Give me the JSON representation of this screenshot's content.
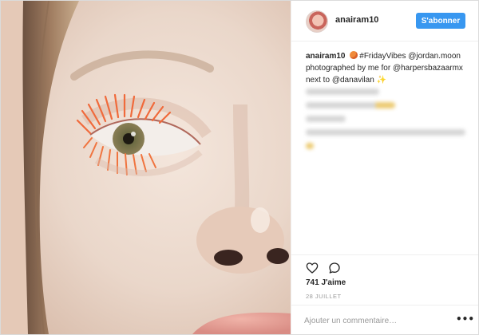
{
  "post": {
    "username": "anairam10",
    "follow_label": "S'abonner",
    "caption": {
      "author": "anairam10",
      "hashtag": "#FridayVibes",
      "mention_1": "@jordan.moon",
      "text_1": "photographed by me for",
      "mention_2": "@harpersbazaarmx",
      "text_2": "next to",
      "mention_3": "@danavilan",
      "emoji_icon": "fire-emoji",
      "sparkle_icon": "sparkles-emoji",
      "sparkle": "✨"
    },
    "likes": "741 J'aime",
    "date": "28 JUILLET",
    "comment_placeholder": "Ajouter un commentaire…",
    "more_label": "•••"
  },
  "icons": {
    "like": "heart-icon",
    "comment": "comment-icon",
    "more": "more-options-icon"
  },
  "colors": {
    "follow_button": "#3897f0",
    "text": "#262626",
    "muted": "#999999",
    "border": "#efefef"
  }
}
